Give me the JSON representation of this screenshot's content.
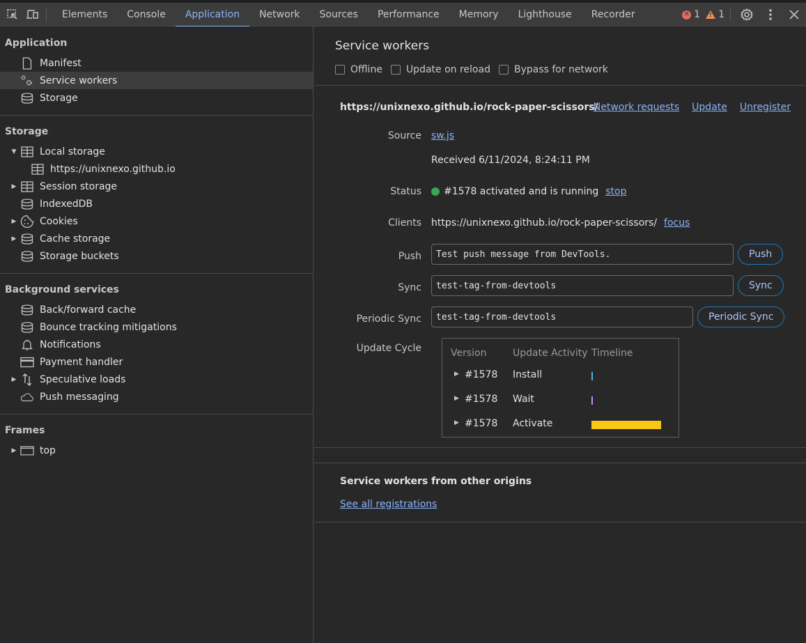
{
  "toolbar": {
    "tabs": [
      "Elements",
      "Console",
      "Application",
      "Network",
      "Sources",
      "Performance",
      "Memory",
      "Lighthouse",
      "Recorder"
    ],
    "active_tab": "Application",
    "error_count": "1",
    "warning_count": "1",
    "accent_color": "#8ab4f8"
  },
  "sidebar": {
    "application": {
      "title": "Application",
      "items": [
        "Manifest",
        "Service workers",
        "Storage"
      ]
    },
    "storage": {
      "title": "Storage",
      "items": [
        "Local storage",
        "https://unixnexo.github.io",
        "Session storage",
        "IndexedDB",
        "Cookies",
        "Cache storage",
        "Storage buckets"
      ]
    },
    "background": {
      "title": "Background services",
      "items": [
        "Back/forward cache",
        "Bounce tracking mitigations",
        "Notifications",
        "Payment handler",
        "Speculative loads",
        "Push messaging"
      ]
    },
    "frames": {
      "title": "Frames",
      "items": [
        "top"
      ]
    }
  },
  "main": {
    "title": "Service workers",
    "checkboxes": [
      "Offline",
      "Update on reload",
      "Bypass for network"
    ],
    "worker": {
      "origin": "https://unixnexo.github.io/rock-paper-scissors/",
      "links": [
        "Network requests",
        "Update",
        "Unregister"
      ],
      "source_label": "Source",
      "source_file": "sw.js",
      "received": "Received 6/11/2024, 8:24:11 PM",
      "status_label": "Status",
      "status_text": "#1578 activated and is running",
      "status_color": "#34a853",
      "stop_link": "stop",
      "clients_label": "Clients",
      "clients_value": "https://unixnexo.github.io/rock-paper-scissors/",
      "focus_link": "focus",
      "push_label": "Push",
      "push_value": "Test push message from DevTools.",
      "push_button": "Push",
      "sync_label": "Sync",
      "sync_value": "test-tag-from-devtools",
      "sync_button": "Sync",
      "periodic_label": "Periodic Sync",
      "periodic_value": "test-tag-from-devtools",
      "periodic_button": "Periodic Sync",
      "update_cycle_label": "Update Cycle",
      "update_cycle": {
        "headers": [
          "Version",
          "Update Activity",
          "Timeline"
        ],
        "rows": [
          {
            "version": "#1578",
            "activity": "Install",
            "color": "#4fb8e0"
          },
          {
            "version": "#1578",
            "activity": "Wait",
            "color": "#c58af9"
          },
          {
            "version": "#1578",
            "activity": "Activate",
            "color": "#f9c716"
          }
        ]
      }
    },
    "other": {
      "title": "Service workers from other origins",
      "link": "See all registrations"
    }
  }
}
